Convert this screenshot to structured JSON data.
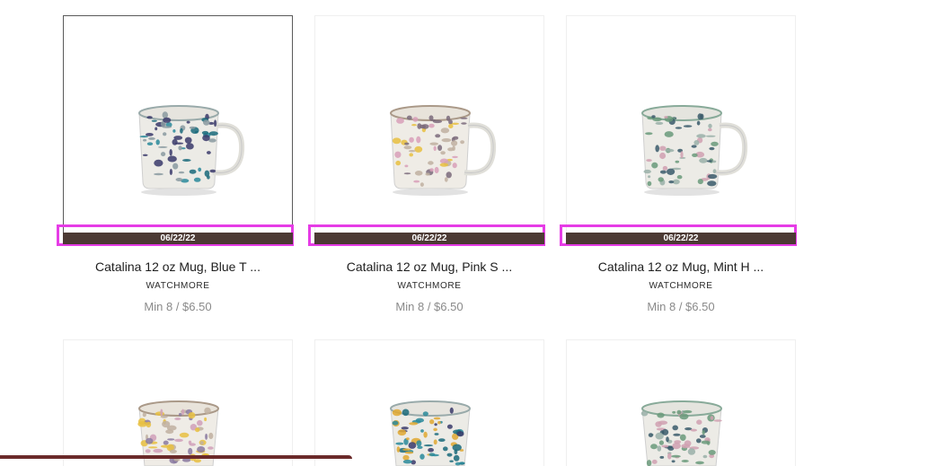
{
  "products": [
    {
      "date": "06/22/22",
      "title": "Catalina 12 oz Mug, Blue T ...",
      "brand": "WATCHMORE",
      "price": "Min 8 / $6.50",
      "image": "speckled-mug-blue"
    },
    {
      "date": "06/22/22",
      "title": "Catalina 12 oz Mug, Pink S ...",
      "brand": "WATCHMORE",
      "price": "Min 8 / $6.50",
      "image": "speckled-mug-pink"
    },
    {
      "date": "06/22/22",
      "title": "Catalina 12 oz Mug, Mint H ...",
      "brand": "WATCHMORE",
      "price": "Min 8 / $6.50",
      "image": "speckled-mug-mint"
    }
  ],
  "next_row": [
    {
      "image": "speckled-tumbler-yellow"
    },
    {
      "image": "speckled-tumbler-teal"
    },
    {
      "image": "speckled-tumbler-green"
    }
  ],
  "colors": {
    "date_bar": "#4c3a34",
    "highlight": "#e63ce6",
    "bottom_strip": "#6b2a2a"
  }
}
